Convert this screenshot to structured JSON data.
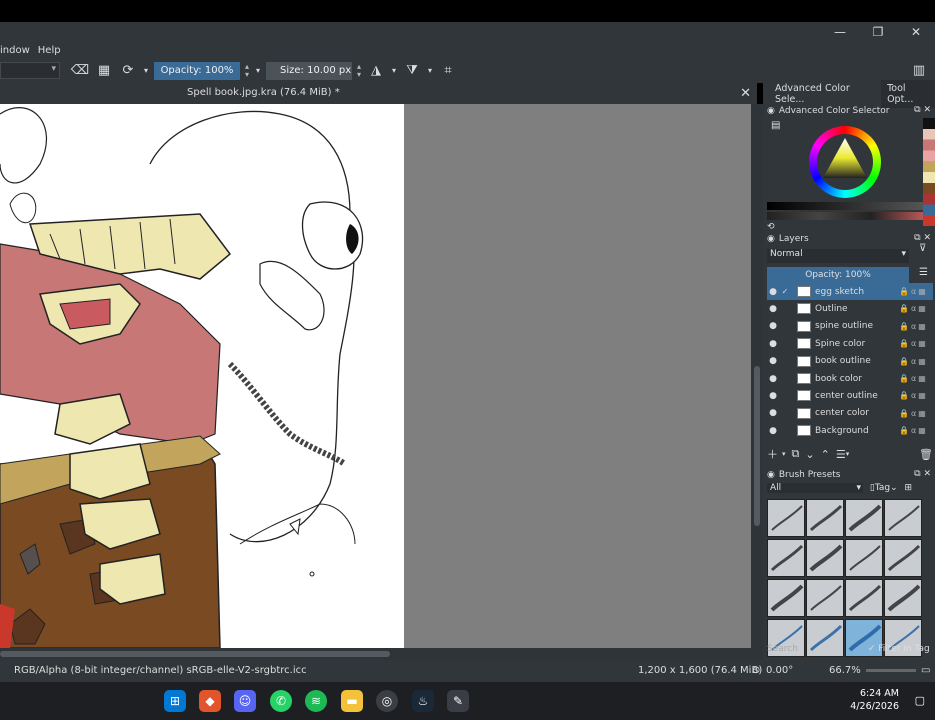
{
  "window_controls": {
    "minimize": "—",
    "restore": "❐",
    "close": "✕"
  },
  "menu": [
    "indow",
    "Help"
  ],
  "toolbar": {
    "opacity_label": "Opacity: 100%",
    "size_label": "Size: 10.00 px"
  },
  "document": {
    "tab_title": "Spell book.jpg.kra (76.4 MiB) *",
    "close": "✕"
  },
  "right_tabs": [
    "Advanced Color Sele...",
    "Tool Opt..."
  ],
  "color_selector": {
    "title": "Advanced Color Selector"
  },
  "layers": {
    "title": "Layers",
    "blend_mode": "Normal",
    "opacity_label": "Opacity: 100%",
    "items": [
      {
        "name": "egg sketch",
        "selected": true
      },
      {
        "name": "Outline",
        "selected": false
      },
      {
        "name": "spine outline",
        "selected": false
      },
      {
        "name": "Spine color",
        "selected": false
      },
      {
        "name": "book outline",
        "selected": false
      },
      {
        "name": "book color",
        "selected": false
      },
      {
        "name": "center outline",
        "selected": false
      },
      {
        "name": "center color",
        "selected": false
      },
      {
        "name": "Background",
        "selected": false
      }
    ]
  },
  "brush_presets": {
    "title": "Brush Presets",
    "filter": "All",
    "tag_label": "Tag",
    "search_placeholder": "Search",
    "filter_in_tag": "Filter in Tag"
  },
  "status": {
    "color_space": "RGB/Alpha (8-bit integer/channel)  sRGB-elle-V2-srgbtrc.icc",
    "dimensions": "1,200 x 1,600 (76.4 MiB)",
    "rotation": "0.00°",
    "zoom": "66.7%"
  },
  "taskbar": {
    "time": "6:24 AM",
    "date": "4/26/2026"
  },
  "colors": {
    "accent": "#3a6a96",
    "panel": "#31363b",
    "canvas_bg": "#7f7f7f"
  }
}
